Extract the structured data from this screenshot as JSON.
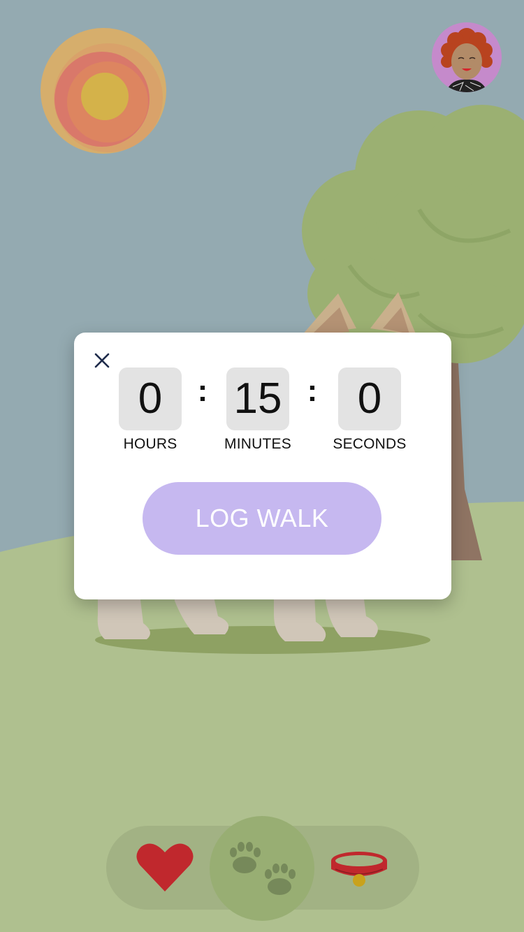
{
  "timer": {
    "hours_value": "0",
    "hours_label": "HOURS",
    "minutes_value": "15",
    "minutes_label": "MINUTES",
    "seconds_value": "0",
    "seconds_label": "SECONDS",
    "separator": ":"
  },
  "dialog": {
    "close_icon": "close-icon",
    "log_button_label": "LOG WALK"
  },
  "nav": {
    "items": [
      {
        "icon": "heart-icon",
        "active": false
      },
      {
        "icon": "paw-prints-icon",
        "active": true
      },
      {
        "icon": "collar-icon",
        "active": false
      }
    ]
  },
  "colors": {
    "sky": "#94aab1",
    "grass": "#afc08f",
    "accent_button": "#c6b8f0",
    "heart": "#c0282d",
    "collar": "#c0282d"
  }
}
